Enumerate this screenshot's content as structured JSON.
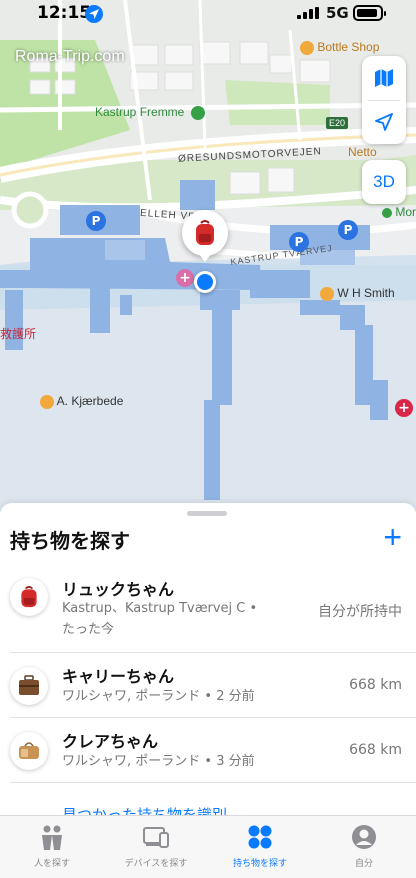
{
  "status_bar": {
    "time": "12:15",
    "network": "5G"
  },
  "map": {
    "watermark": "Roma-Trip.com",
    "labels": {
      "bottle_shop": "Bottle Shop",
      "kastrup_fremme": "Kastrup Fremme",
      "e20": "E20",
      "oresund": "ØRESUNDSMOTORVEJEN",
      "netto": "Netto",
      "mor": "Mor",
      "ellehammersvej": "ELLEH      VEJ",
      "kastrup_tvaervej": "KASTRUP TVÆRVEJ",
      "wh_smith": "W H Smith",
      "first_aid": "救護所",
      "kjaerbede": "A. Kjærbede"
    },
    "buttons": {
      "map_mode_icon": "map-icon",
      "location_icon": "location-arrow-icon",
      "mode_3d": "3D"
    },
    "colors": {
      "land": "#eceef0",
      "water": "#c3d8ec",
      "terminal": "#8fb4e4",
      "park": "#bfe3a6",
      "road": "#ffffff",
      "highway": "#f4d98c",
      "user_dot": "#0a7aff"
    }
  },
  "sheet": {
    "title": "持ち物を探す",
    "add_label": "+",
    "items": [
      {
        "name": "リュックちゃん",
        "location": "Kastrup、Kastrup Tværvej C •",
        "time": "たった今",
        "status": "自分が所持中",
        "icon": "backpack-icon"
      },
      {
        "name": "キャリーちゃん",
        "location": "ワルシャワ, ポーランド • 2 分前",
        "status": "668 km",
        "icon": "suitcase-icon"
      },
      {
        "name": "クレアちゃん",
        "location": "ワルシャワ, ポーランド • 3 分前",
        "status": "668 km",
        "icon": "bag-icon"
      }
    ],
    "identify_link": "見つかった持ち物を識別"
  },
  "tabs": [
    {
      "label": "人を探す",
      "icon": "people-icon"
    },
    {
      "label": "デバイスを探す",
      "icon": "devices-icon"
    },
    {
      "label": "持ち物を探す",
      "icon": "items-icon",
      "active": true
    },
    {
      "label": "自分",
      "icon": "me-icon"
    }
  ]
}
